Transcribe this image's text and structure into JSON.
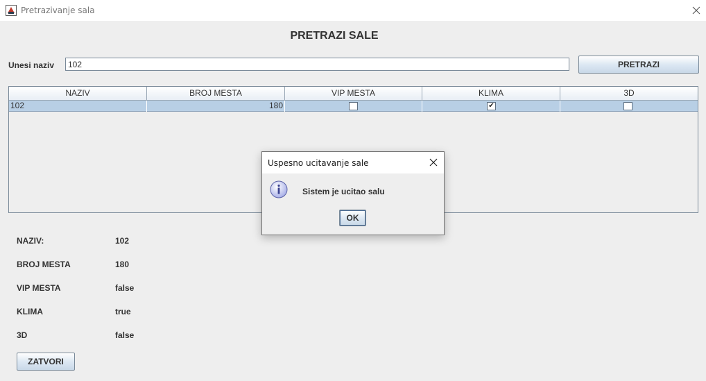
{
  "window": {
    "title": "Pretrazivanje sala",
    "app_icon": "java-app-icon",
    "close_icon": "close-icon"
  },
  "main": {
    "heading": "PRETRAZI SALE",
    "search_label": "Unesi naziv",
    "search_value": "102",
    "search_button": "PRETRAZI"
  },
  "table": {
    "columns": [
      "NAZIV",
      "BROJ MESTA",
      "VIP MESTA",
      "KLIMA",
      "3D"
    ],
    "rows": [
      {
        "naziv": "102",
        "broj_mesta": "180",
        "vip_mesta": false,
        "klima": true,
        "three_d": false
      }
    ],
    "selected_row_color": "#b8cfe5"
  },
  "details": {
    "naziv_label": "NAZIV:",
    "naziv_value": "102",
    "broj_mesta_label": "BROJ MESTA",
    "broj_mesta_value": "180",
    "vip_mesta_label": "VIP MESTA",
    "vip_mesta_value": "false",
    "klima_label": "KLIMA",
    "klima_value": "true",
    "three_d_label": "3D",
    "three_d_value": "false"
  },
  "close_button": "ZATVORI",
  "dialog": {
    "title": "Uspesno ucitavanje sale",
    "message": "Sistem je ucitao salu",
    "ok_label": "OK",
    "icon": "info-icon"
  }
}
